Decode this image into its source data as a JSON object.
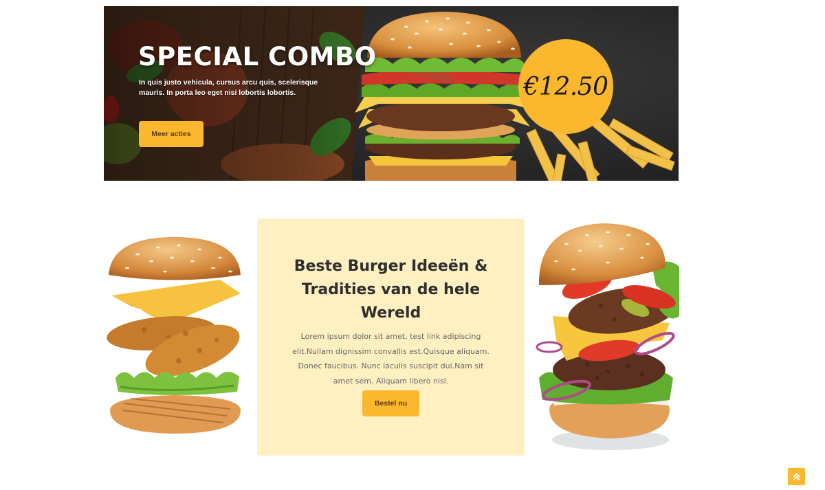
{
  "hero": {
    "title": "SPECIAL COMBO",
    "text": "In quis justo vehicula, cursus arcu quis, scelerisque mauris. In porta leo eget nisi lobortis lobortis.",
    "button_label": "Meer acties",
    "price": "€12.50"
  },
  "promo": {
    "title": "Beste Burger Ideeën & Tradities van de hele Wereld",
    "text": "Lorem ipsum dolor sit amet, test link adipiscing elit.Nullam dignissim convallis est.Quisque aliquam. Donec faucibus. Nunc iaculis suscipit dui.Nam sit amet sem. Aliquam libero nisi.",
    "button_label": "Bestel nu"
  },
  "scroll_top": {
    "icon": "double-chevron-up-icon"
  },
  "colors": {
    "accent": "#fbb72e",
    "card_bg": "#fff0c2",
    "heading": "#2f2f2f",
    "body_text": "#666666"
  }
}
